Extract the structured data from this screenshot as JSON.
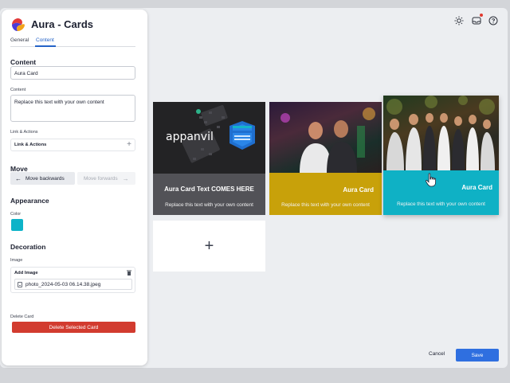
{
  "app": {
    "title": "Aura - Cards"
  },
  "tabs": [
    {
      "label": "General"
    },
    {
      "label": "Content"
    }
  ],
  "content_section": {
    "heading": "Content",
    "title_value": "Aura Card",
    "content_label": "Content",
    "content_value": "Replace this text with your own content",
    "links_label": "Link & Actions",
    "links_row": "Link & Actions"
  },
  "move_section": {
    "heading": "Move",
    "back_label": "Move backwards",
    "forward_label": "Move forwards"
  },
  "appearance_section": {
    "heading": "Appearance",
    "color_label": "Color",
    "color_value": "#0db3c8"
  },
  "decoration_section": {
    "heading": "Decoration",
    "image_label": "Image",
    "add_image": "Add Image",
    "file_name": "photo_2024-05-03 06.14.38.jpeg"
  },
  "delete_section": {
    "label": "Delete Card",
    "button": "Delete Selected Card"
  },
  "cards": [
    {
      "title": "Aura Card Text COMES HERE",
      "subtitle": "Replace this text with your own content",
      "logo_text": "appanvil",
      "color": "#525257"
    },
    {
      "title": "Aura Card",
      "subtitle": "Replace this text with your own content",
      "color": "#c8a10a"
    },
    {
      "title": "Aura Card",
      "subtitle": "Replace this text with your own content",
      "color": "#0fb1c5"
    }
  ],
  "add_card_symbol": "+",
  "footer": {
    "cancel": "Cancel",
    "save": "Save"
  },
  "icons": {
    "theme": "sun-icon",
    "inbox": "inbox-icon",
    "help": "help-icon"
  }
}
